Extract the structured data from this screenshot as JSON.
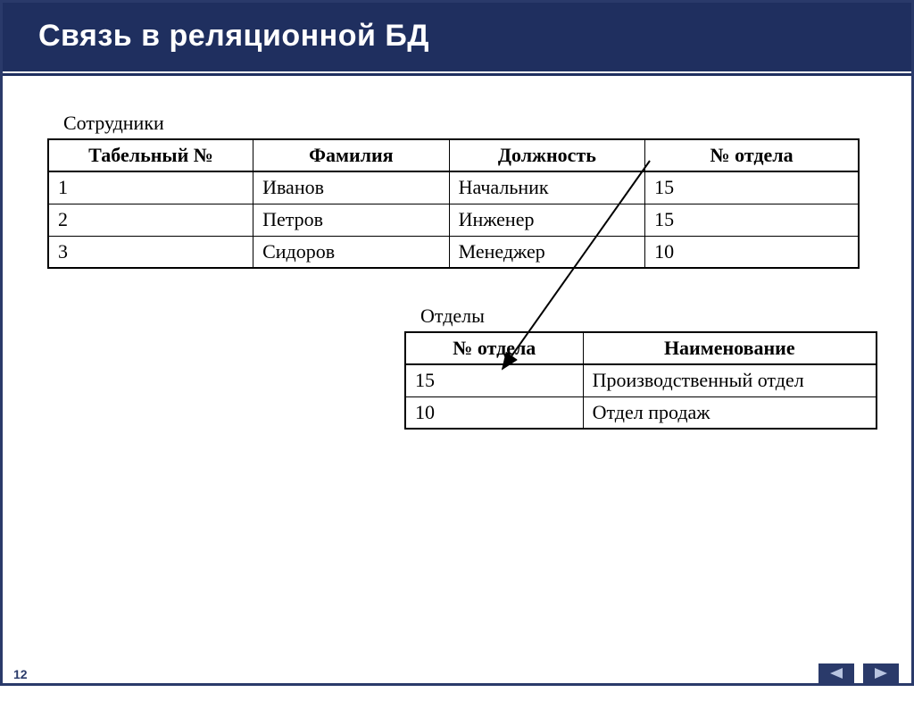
{
  "slide": {
    "title": "Связь в реляционной БД",
    "page_number": "12"
  },
  "employees": {
    "caption": "Сотрудники",
    "headers": [
      "Табельный №",
      "Фамилия",
      "Должность",
      "№ отдела"
    ],
    "rows": [
      [
        "1",
        "Иванов",
        "Начальник",
        "15"
      ],
      [
        "2",
        "Петров",
        "Инженер",
        "15"
      ],
      [
        "3",
        "Сидоров",
        "Менеджер",
        "10"
      ]
    ]
  },
  "departments": {
    "caption": "Отделы",
    "headers": [
      "№ отдела",
      "Наименование"
    ],
    "rows": [
      [
        "15",
        "Производственный отдел"
      ],
      [
        "10",
        "Отдел продаж"
      ]
    ]
  }
}
